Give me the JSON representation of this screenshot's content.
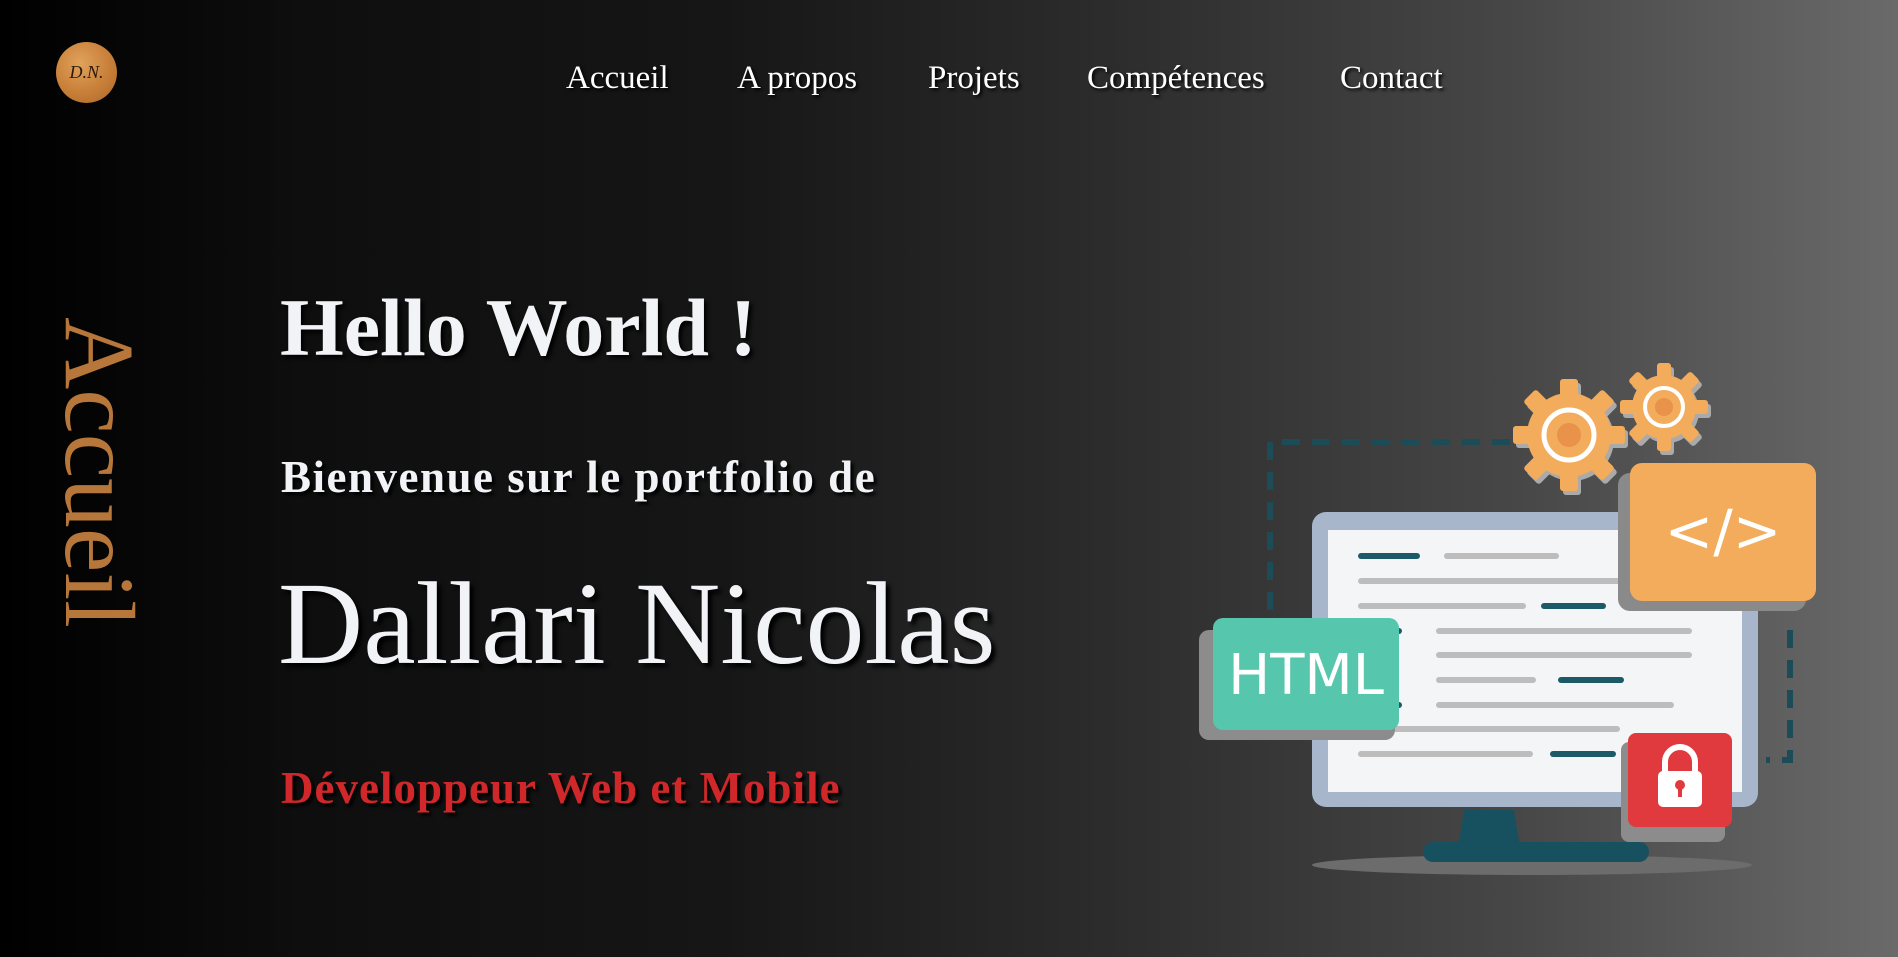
{
  "logo": {
    "text": "D.N."
  },
  "nav": {
    "items": [
      {
        "label": "Accueil"
      },
      {
        "label": "A propos"
      },
      {
        "label": "Projets"
      },
      {
        "label": "Compétences"
      },
      {
        "label": "Contact"
      }
    ]
  },
  "section": {
    "side_title": "Accueil"
  },
  "hero": {
    "greeting": "Hello World !",
    "welcome": "Bienvenue sur le portfolio de",
    "name": "Dallari Nicolas",
    "role": "Développeur Web et Mobile"
  },
  "illustration": {
    "html_badge": "HTML",
    "code_badge": "</>",
    "icons": [
      "gear-icon",
      "gear-icon",
      "code-icon",
      "lock-icon",
      "monitor-icon"
    ]
  },
  "colors": {
    "accent": "#b8773a",
    "role_red": "#d0282a",
    "text": "#f1f3f7",
    "html_green": "#56c7ad",
    "code_orange": "#f2ac5c",
    "lock_red": "#e03a3e",
    "monitor_stand": "#17505e"
  }
}
